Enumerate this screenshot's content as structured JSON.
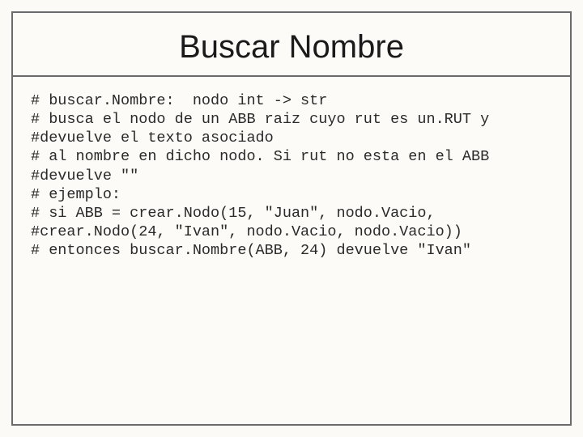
{
  "slide": {
    "title": "Buscar Nombre",
    "code_lines": [
      "# buscar.Nombre:  nodo int -> str",
      "# busca el nodo de un ABB raiz cuyo rut es un.RUT y",
      "#devuelve el texto asociado",
      "# al nombre en dicho nodo. Si rut no esta en el ABB",
      "#devuelve \"\"",
      "# ejemplo:",
      "# si ABB = crear.Nodo(15, \"Juan\", nodo.Vacio,",
      "#crear.Nodo(24, \"Ivan\", nodo.Vacio, nodo.Vacio))",
      "# entonces buscar.Nombre(ABB, 24) devuelve \"Ivan\""
    ]
  }
}
